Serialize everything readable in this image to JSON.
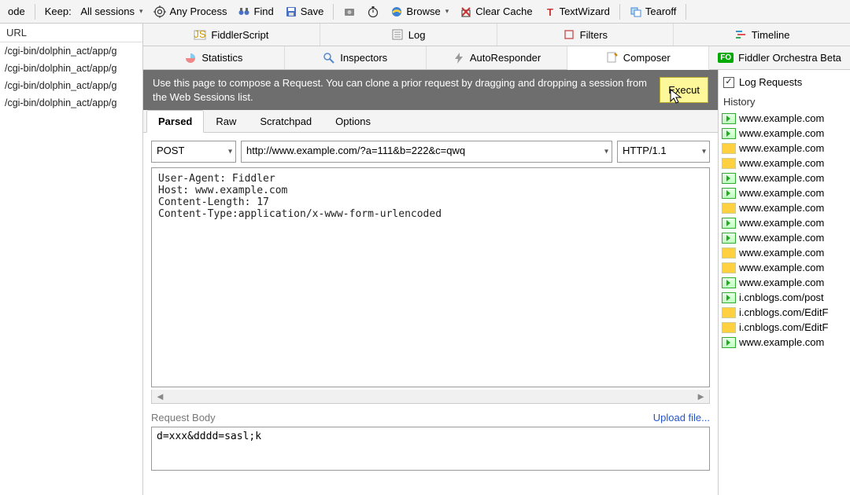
{
  "toolbar": {
    "decode": "ode",
    "keep_label": "Keep:",
    "keep_value": "All sessions",
    "any_process": "Any Process",
    "find": "Find",
    "save": "Save",
    "browse": "Browse",
    "clear_cache": "Clear Cache",
    "text_wizard": "TextWizard",
    "tearoff": "Tearoff"
  },
  "sidebar": {
    "header": "URL",
    "sessions": [
      "/cgi-bin/dolphin_act/app/g",
      "/cgi-bin/dolphin_act/app/g",
      "/cgi-bin/dolphin_act/app/g",
      "/cgi-bin/dolphin_act/app/g"
    ]
  },
  "tabs_row1": {
    "fiddlerscript": "FiddlerScript",
    "log": "Log",
    "filters": "Filters",
    "timeline": "Timeline"
  },
  "tabs_row2": {
    "statistics": "Statistics",
    "inspectors": "Inspectors",
    "autoresponder": "AutoResponder",
    "composer": "Composer",
    "orchestra": "Fiddler Orchestra Beta"
  },
  "composer": {
    "banner": "Use this page to compose a Request. You can clone a prior request by dragging and dropping a session from the Web Sessions list.",
    "execute": "Execut",
    "sub_tabs": {
      "parsed": "Parsed",
      "raw": "Raw",
      "scratchpad": "Scratchpad",
      "options": "Options"
    },
    "method": "POST",
    "url": "http://www.example.com/?a=111&b=222&c=qwq",
    "http_version": "HTTP/1.1",
    "headers": "User-Agent: Fiddler\nHost: www.example.com\nContent-Length: 17\nContent-Type:application/x-www-form-urlencoded",
    "body_label": "Request Body",
    "upload": "Upload file...",
    "body": "d=xxx&dddd=sasl;k"
  },
  "history": {
    "log_requests": "Log Requests",
    "checked": true,
    "title": "History",
    "items": [
      {
        "type": "green",
        "text": "www.example.com"
      },
      {
        "type": "green",
        "text": "www.example.com"
      },
      {
        "type": "yellow",
        "text": "www.example.com"
      },
      {
        "type": "yellow",
        "text": "www.example.com"
      },
      {
        "type": "green",
        "text": "www.example.com"
      },
      {
        "type": "green",
        "text": "www.example.com"
      },
      {
        "type": "yellow",
        "text": "www.example.com"
      },
      {
        "type": "green",
        "text": "www.example.com"
      },
      {
        "type": "green",
        "text": "www.example.com"
      },
      {
        "type": "yellow",
        "text": "www.example.com"
      },
      {
        "type": "yellow",
        "text": "www.example.com"
      },
      {
        "type": "green",
        "text": "www.example.com"
      },
      {
        "type": "green",
        "text": "i.cnblogs.com/post"
      },
      {
        "type": "yellow",
        "text": "i.cnblogs.com/EditF"
      },
      {
        "type": "yellow",
        "text": "i.cnblogs.com/EditF"
      },
      {
        "type": "green",
        "text": "www.example.com"
      }
    ]
  }
}
